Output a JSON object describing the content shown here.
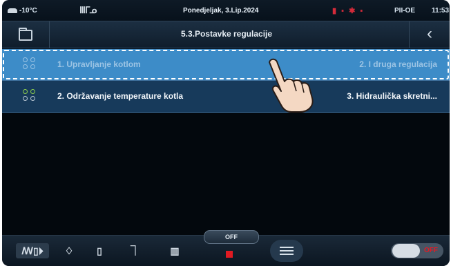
{
  "status_bar": {
    "outdoor_temp": "-10°C",
    "date": "Ponedjeljak, 3.Lip.2024",
    "mode": "PII-OE",
    "time": "11:53"
  },
  "header": {
    "title": "5.3.Postavke regulacije",
    "back_symbol": "‹",
    "folder_icon": "folder-icon"
  },
  "list": {
    "items": [
      {
        "label": "1. Upravljanje kotlom",
        "value": "2. I druga regulacija",
        "selected": true
      },
      {
        "label": "2. Održavanje temperature kotla",
        "value": "3. Hidraulička skretni...",
        "selected": false
      }
    ]
  },
  "bottom_bar": {
    "off_label": "OFF",
    "toggle_label": "OFF",
    "icons": [
      "heating-mode-icon",
      "flame-icon",
      "tank-icon",
      "tap-icon",
      "radiator-icon",
      "menu-icon"
    ]
  },
  "colors": {
    "selected_row": "#3d8cc8",
    "row": "#173a5b",
    "stop": "#e01a22"
  }
}
